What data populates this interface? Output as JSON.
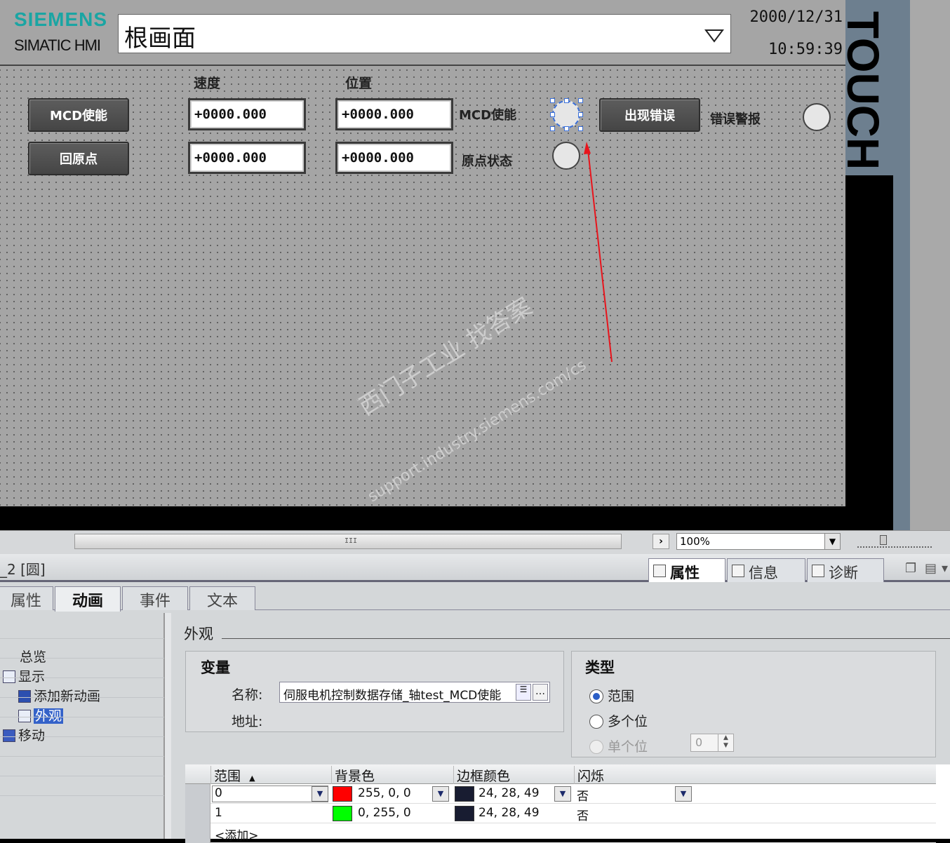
{
  "hmi": {
    "brand": "SIEMENS",
    "product": "SIMATIC HMI",
    "screen_name": "根画面",
    "date": "2000/12/31",
    "time": "10:59:39",
    "col_speed": "速度",
    "col_position": "位置",
    "btn_mcd_enable": "MCD使能",
    "btn_home": "回原点",
    "speed_1": "+0000.000",
    "speed_2": "+0000.000",
    "pos_1": "+0000.000",
    "pos_2": "+0000.000",
    "label_mcd_enable": "MCD使能",
    "label_home_state": "原点状态",
    "btn_error": "出现错误",
    "label_error_alarm": "错误警报",
    "side_brand": "TOUCH",
    "watermark_cn": "西门子工业 找答案",
    "watermark_url": "support.industry.siemens.com/cs"
  },
  "canvas": {
    "scroll_grip": "III",
    "zoom": "100%"
  },
  "inspector": {
    "object_title": "_2 [圆]",
    "right_tabs": [
      "属性",
      "信息",
      "诊断"
    ],
    "sub_tabs": [
      "属性",
      "动画",
      "事件",
      "文本"
    ],
    "tree": {
      "overview": "总览",
      "display": "显示",
      "add_animation": "添加新动画",
      "appearance": "外观",
      "move": "移动"
    },
    "section": "外观",
    "variable": {
      "title": "变量",
      "name_label": "名称:",
      "name_value": "伺服电机控制数据存储_轴test_MCD使能",
      "address_label": "地址:"
    },
    "type": {
      "title": "类型",
      "options": [
        "范围",
        "多个位",
        "单个位"
      ],
      "selected": "范围",
      "bit_value": "0"
    },
    "table": {
      "headers": [
        "范围",
        "背景色",
        "边框颜色",
        "闪烁"
      ],
      "rows": [
        {
          "range": "0",
          "bg": "255, 0, 0",
          "bg_color": "#ff0000",
          "border": "24, 28, 49",
          "border_color": "#181c31",
          "blink": "否"
        },
        {
          "range": "1",
          "bg": "0, 255, 0",
          "bg_color": "#00ff00",
          "border": "24, 28, 49",
          "border_color": "#181c31",
          "blink": "否"
        }
      ],
      "add_row": "<添加>"
    }
  }
}
